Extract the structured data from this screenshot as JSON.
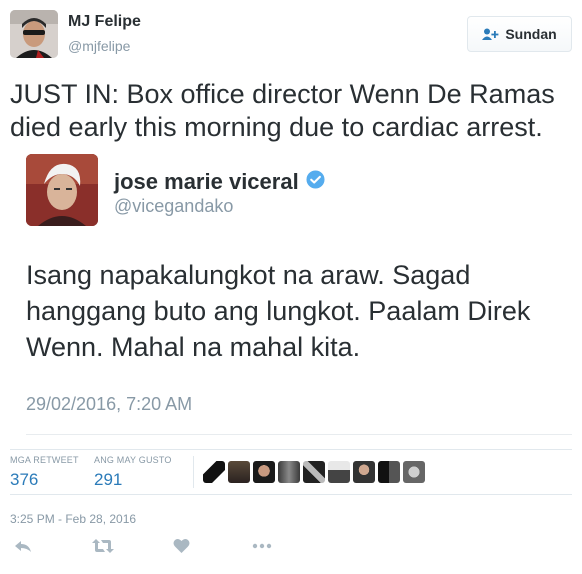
{
  "tweet": {
    "author_name": "MJ Felipe",
    "author_handle": "@mjfelipe",
    "follow_label": "Sundan",
    "text": "JUST IN: Box office director Wenn De Ramas died early this morning due to cardiac arrest.",
    "timestamp": "3:25 PM - Feb 28, 2016"
  },
  "quoted": {
    "name": "jose marie viceral",
    "handle": "@vicegandako",
    "text": "Isang napakalungkot na araw. Sagad hanggang buto ang lungkot. Paalam Direk Wenn. Mahal na mahal kita.",
    "date": "29/02/2016, 7:20 AM"
  },
  "stats": {
    "retweets_label": "MGA RETWEET",
    "retweets": "376",
    "likes_label": "ANG MAY GUSTO",
    "likes": "291"
  },
  "colors": {
    "accent_blue": "#2b7bb9",
    "verified_blue": "#55acee",
    "muted": "#8899a6",
    "text": "#292f33"
  },
  "icons": [
    "follow-person-icon",
    "verified-badge-icon",
    "reply-icon",
    "retweet-icon",
    "like-heart-icon",
    "more-dots-icon"
  ]
}
